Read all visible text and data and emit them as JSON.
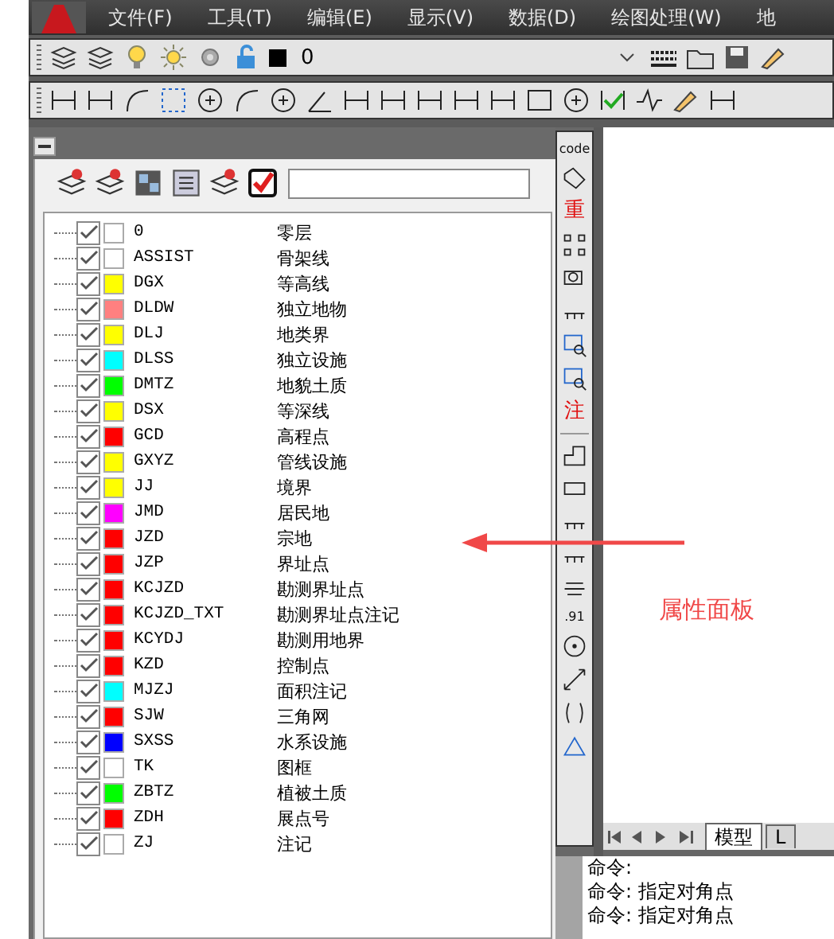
{
  "menu": [
    "文件(F)",
    "工具(T)",
    "编辑(E)",
    "显示(V)",
    "数据(D)",
    "绘图处理(W)",
    "地"
  ],
  "layer_combo": {
    "value": "0"
  },
  "layers": [
    {
      "name": "0",
      "desc": "零层",
      "checked": true,
      "color": "#ffffff"
    },
    {
      "name": "ASSIST",
      "desc": "骨架线",
      "checked": true,
      "color": "#ffffff"
    },
    {
      "name": "DGX",
      "desc": "等高线",
      "checked": true,
      "color": "#ffff00"
    },
    {
      "name": "DLDW",
      "desc": "独立地物",
      "checked": true,
      "color": "#ff8080"
    },
    {
      "name": "DLJ",
      "desc": "地类界",
      "checked": true,
      "color": "#ffff00"
    },
    {
      "name": "DLSS",
      "desc": "独立设施",
      "checked": true,
      "color": "#00ffff"
    },
    {
      "name": "DMTZ",
      "desc": "地貌土质",
      "checked": true,
      "color": "#00ff00"
    },
    {
      "name": "DSX",
      "desc": "等深线",
      "checked": true,
      "color": "#ffff00"
    },
    {
      "name": "GCD",
      "desc": "高程点",
      "checked": true,
      "color": "#ff0000"
    },
    {
      "name": "GXYZ",
      "desc": "管线设施",
      "checked": true,
      "color": "#ffff00"
    },
    {
      "name": "JJ",
      "desc": "境界",
      "checked": true,
      "color": "#ffff00"
    },
    {
      "name": "JMD",
      "desc": "居民地",
      "checked": true,
      "color": "#ff00ff"
    },
    {
      "name": "JZD",
      "desc": "宗地",
      "checked": true,
      "color": "#ff0000"
    },
    {
      "name": "JZP",
      "desc": "界址点",
      "checked": true,
      "color": "#ff0000"
    },
    {
      "name": "KCJZD",
      "desc": "勘测界址点",
      "checked": true,
      "color": "#ff0000"
    },
    {
      "name": "KCJZD_TXT",
      "desc": "勘测界址点注记",
      "checked": true,
      "color": "#ff0000"
    },
    {
      "name": "KCYDJ",
      "desc": "勘测用地界",
      "checked": true,
      "color": "#ff0000"
    },
    {
      "name": "KZD",
      "desc": "控制点",
      "checked": true,
      "color": "#ff0000"
    },
    {
      "name": "MJZJ",
      "desc": "面积注记",
      "checked": true,
      "color": "#00ffff"
    },
    {
      "name": "SJW",
      "desc": "三角网",
      "checked": true,
      "color": "#ff0000"
    },
    {
      "name": "SXSS",
      "desc": "水系设施",
      "checked": true,
      "color": "#0000ff"
    },
    {
      "name": "TK",
      "desc": "图框",
      "checked": true,
      "color": "#ffffff"
    },
    {
      "name": "ZBTZ",
      "desc": "植被土质",
      "checked": true,
      "color": "#00ff00"
    },
    {
      "name": "ZDH",
      "desc": "展点号",
      "checked": true,
      "color": "#ff0000"
    },
    {
      "name": "ZJ",
      "desc": "注记",
      "checked": true,
      "color": "#ffffff"
    }
  ],
  "vertical_toolbar": [
    {
      "kind": "glyph",
      "text": "code"
    },
    {
      "kind": "icon"
    },
    {
      "kind": "glyph",
      "text": "重"
    },
    {
      "kind": "icon"
    },
    {
      "kind": "icon"
    },
    {
      "kind": "icon"
    },
    {
      "kind": "icon"
    },
    {
      "kind": "icon"
    },
    {
      "kind": "glyph",
      "text": "注"
    },
    {
      "kind": "separator"
    },
    {
      "kind": "icon"
    },
    {
      "kind": "icon"
    },
    {
      "kind": "icon"
    },
    {
      "kind": "icon"
    },
    {
      "kind": "icon"
    },
    {
      "kind": "glyph",
      "text": ".91"
    },
    {
      "kind": "icon"
    },
    {
      "kind": "icon"
    },
    {
      "kind": "icon"
    },
    {
      "kind": "icon"
    }
  ],
  "layout_tabs": [
    {
      "label": "模型",
      "selected": true
    },
    {
      "label": "L",
      "selected": false
    }
  ],
  "annotation": {
    "text": "属性面板"
  },
  "command_lines": [
    "命令:",
    "命令: 指定对角点",
    "命令: 指定对角点"
  ]
}
